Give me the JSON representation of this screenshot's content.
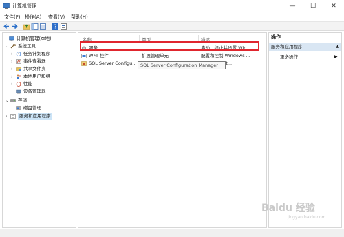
{
  "window": {
    "title": "计算机管理",
    "minimize": "—",
    "maximize": "☐",
    "close": "✕"
  },
  "menu": [
    "文件(F)",
    "操作(A)",
    "查看(V)",
    "帮助(H)"
  ],
  "tree": {
    "items": [
      {
        "label": "计算机管理(本地)",
        "icon": "computer-icon",
        "expander": ""
      },
      {
        "label": "系统工具",
        "icon": "tools-icon",
        "expander": "⌄"
      },
      {
        "label": "任务计划程序",
        "icon": "clock-icon",
        "expander": "›"
      },
      {
        "label": "事件查看器",
        "icon": "event-viewer-icon",
        "expander": "›"
      },
      {
        "label": "共享文件夹",
        "icon": "shared-folder-icon",
        "expander": "›"
      },
      {
        "label": "本地用户和组",
        "icon": "users-icon",
        "expander": "›"
      },
      {
        "label": "性能",
        "icon": "performance-icon",
        "expander": "›"
      },
      {
        "label": "设备管理器",
        "icon": "device-manager-icon",
        "expander": ""
      },
      {
        "label": "存储",
        "icon": "storage-icon",
        "expander": "⌄"
      },
      {
        "label": "磁盘管理",
        "icon": "disk-icon",
        "expander": ""
      },
      {
        "label": "服务和应用程序",
        "icon": "services-apps-icon",
        "expander": "›"
      }
    ]
  },
  "list": {
    "columns": [
      "名称",
      "类型",
      "描述"
    ],
    "rows": [
      {
        "name": "服务",
        "type": "",
        "desc": "启动、终止并设置 Win...",
        "icon": "gear-icon"
      },
      {
        "name": "WMI 控件",
        "type": "扩展管理单元",
        "desc": "配置和控制 Windows ...",
        "icon": "wmi-icon"
      },
      {
        "name": "SQL Server Configu...",
        "type": "",
        "desc": "r Configurat...",
        "icon": "sql-server-icon"
      }
    ],
    "tooltip": "SQL Server Configuration Manager"
  },
  "actions": {
    "header": "操作",
    "section": "服务和应用程序",
    "section_caret": "▲",
    "more": "更多操作",
    "more_arrow": "▶"
  },
  "watermark": {
    "text": "Baidu 经验",
    "sub": "jingyan.baidu.com"
  }
}
